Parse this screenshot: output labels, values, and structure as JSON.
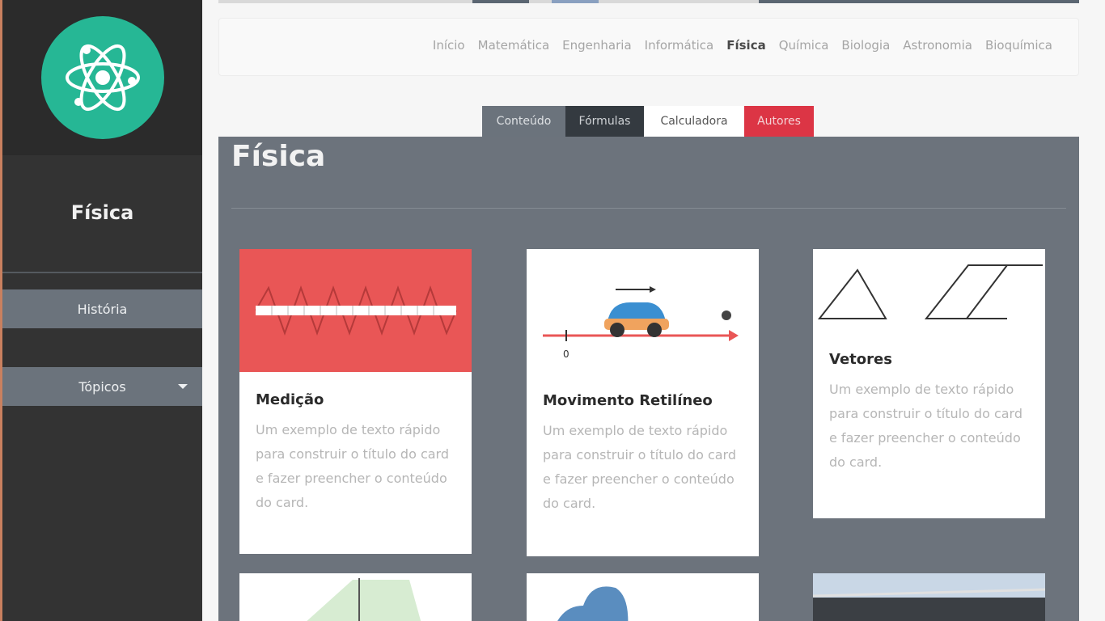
{
  "sidebar": {
    "logo_icon": "atom-icon",
    "title": "Física",
    "items": [
      {
        "label": "História"
      },
      {
        "label": "Tópicos",
        "icon": "caret-down-icon"
      }
    ]
  },
  "nav": {
    "links": [
      "Início",
      "Matemática",
      "Engenharia",
      "Informática",
      "Física",
      "Química",
      "Biologia",
      "Astronomia",
      "Bioquímica"
    ],
    "active": "Física"
  },
  "tabs": [
    "Conteúdo",
    "Fórmulas",
    "Calculadora",
    "Autores"
  ],
  "page": {
    "title": "Física"
  },
  "cards": [
    {
      "title": "Medição",
      "text": "Um exemplo de texto rápido para construir o título do card e fazer preencher o conteúdo do card."
    },
    {
      "title": "Movimento Retilíneo",
      "text": "Um exemplo de texto rápido para construir o título do card e fazer preencher o conteúdo do card.",
      "diagram_label": "0"
    },
    {
      "title": "Vetores",
      "text": "Um exemplo de texto rápido para construir o título do card e fazer preencher o conteúdo do card."
    }
  ],
  "colors": {
    "brand": "#26b795",
    "sidebar": "#333333",
    "panel": "#6c737c",
    "danger": "#dc3545"
  }
}
